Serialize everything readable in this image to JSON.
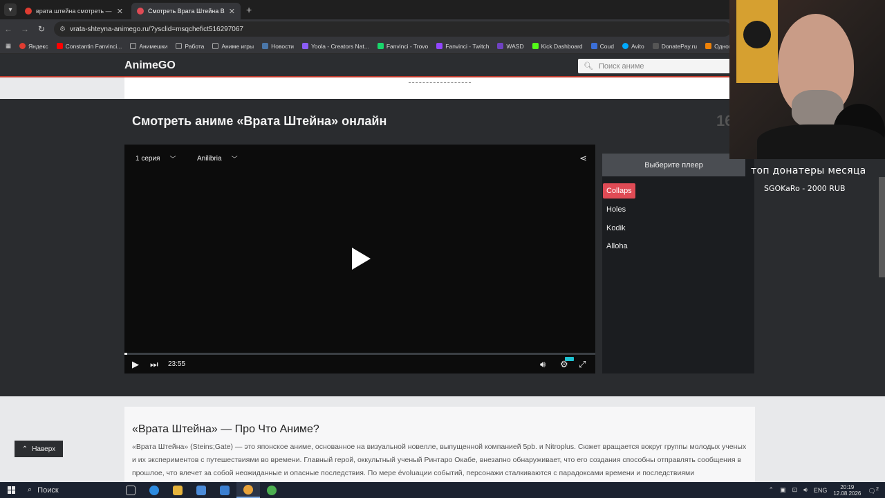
{
  "browser": {
    "tabs": [
      {
        "title": "врата штейна смотреть — Яндекс",
        "favicon_color": "#e03c31"
      },
      {
        "title": "Смотреть Врата Штейна Все Серии",
        "favicon_color": "#e04b55"
      }
    ],
    "new_tab_label": "+",
    "url_prefix": "⚙",
    "url": "vrata-shteyna-animego.ru/?ysclid=msqchefict516297067",
    "bookmarks": [
      {
        "label": "Яндекс",
        "color": "#e03c31"
      },
      {
        "label": "Constantin Fanvinci...",
        "color": "#ff0000"
      },
      {
        "label": "Анимешки",
        "color": "#aaaaaa"
      },
      {
        "label": "Работа",
        "color": "#aaaaaa"
      },
      {
        "label": "Аниме игры",
        "color": "#aaaaaa"
      },
      {
        "label": "Новости",
        "color": "#4a76a8"
      },
      {
        "label": "Yoola - Creators Nat...",
        "color": "#8a5cf6"
      },
      {
        "label": "Fanvinci - Trovo",
        "color": "#19d66b"
      },
      {
        "label": "Fanvinci - Twitch",
        "color": "#9146ff"
      },
      {
        "label": "WASD",
        "color": "#6f42c1"
      },
      {
        "label": "Kick Dashboard",
        "color": "#53fc18"
      },
      {
        "label": "Coud",
        "color": "#3b6fd8"
      },
      {
        "label": "Avito",
        "color": "#00aaff"
      },
      {
        "label": "DonatePay.ru",
        "color": "#333333"
      },
      {
        "label": "Одноклассн",
        "color": "#ee8208"
      }
    ]
  },
  "site": {
    "logo": "AnimeGO",
    "search_placeholder": "Поиск аниме",
    "watch_title": "Смотреть аниме «Врата Штейна» онлайн",
    "rating_peek": "16"
  },
  "player": {
    "episode": "1 серия",
    "dub": "Anilibria",
    "duration": "23:55",
    "progress": 0.005,
    "choose_label": "Выберите плеер",
    "players": [
      "Collaps",
      "Holes",
      "Kodik",
      "Alloha"
    ],
    "active_player": "Collaps"
  },
  "overlay": {
    "line1": "топ донатеры месяца",
    "line2": "SGOKaRo - 2000 RUB"
  },
  "description": {
    "title": "«Врата Штейна» — Про Что Аниме?",
    "text": "«Врата Штейна» (Steins;Gate) — это японское аниме, основанное на визуальной новелле, выпущенной компанией 5pb. и Nitroplus. Сюжет вращается вокруг группы молодых ученых и их экспериментов с путешествиями во времени. Главный герой, оккультный ученый Ринтаро Окабе, внезапно обнаруживает, что его создания способны отправлять сообщения в прошлое, что влечет за собой неожиданные и опасные последствия. По мере évoluации событий, персонажи сталкиваются с парадоксами времени и последствиями"
  },
  "to_top": "Наверх",
  "taskbar": {
    "search_label": "Поиск",
    "lang": "ENG",
    "time": "20:19",
    "date": "12.08.2026",
    "notifications": "2"
  }
}
